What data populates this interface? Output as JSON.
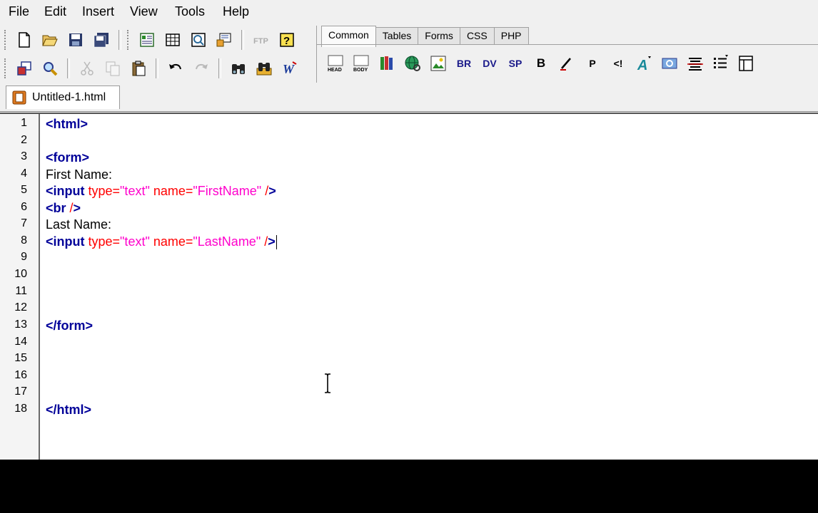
{
  "menu": [
    "File",
    "Edit",
    "Insert",
    "View",
    "Tools",
    "Help"
  ],
  "toolbar": {
    "ftp_label": "FTP"
  },
  "insert_bar": {
    "tabs": [
      "Common",
      "Tables",
      "Forms",
      "CSS",
      "PHP"
    ],
    "active_tab": "Common",
    "icon_labels": {
      "head": "HEAD",
      "body": "BODY",
      "br": "BR",
      "div": "DV",
      "span": "SP",
      "bold": "B",
      "paragraph": "P",
      "comment": "<!"
    }
  },
  "document_tab": {
    "filename": "Untitled-1.html"
  },
  "editor": {
    "line_numbers": [
      "1",
      "2",
      "3",
      "4",
      "5",
      "6",
      "7",
      "8",
      "9",
      "10",
      "11",
      "12",
      "13",
      "14",
      "15",
      "16",
      "17",
      "18"
    ],
    "lines": {
      "l1": "<html>",
      "l3": "<form>",
      "l4": "First Name:",
      "l5_tag": "<input",
      "l5_attr1": " type=",
      "l5_val1": "\"text\"",
      "l5_attr2": " name=",
      "l5_val2": "\"FirstName\"",
      "l5_end_attr": " /",
      "l5_end": ">",
      "l6_tag": "<br",
      "l6_end_attr": " /",
      "l6_end": ">",
      "l7": "Last Name:",
      "l8_tag": "<input",
      "l8_attr1": " type=",
      "l8_val1": "\"text\"",
      "l8_attr2": " name=",
      "l8_val2": "\"LastName\"",
      "l8_end_attr": " /",
      "l8_end": ">",
      "l13": "</form>",
      "l18": "</html>"
    }
  },
  "colors": {
    "tag": "#000099",
    "attribute": "#ff0000",
    "value": "#ff00cc",
    "text": "#000000"
  }
}
